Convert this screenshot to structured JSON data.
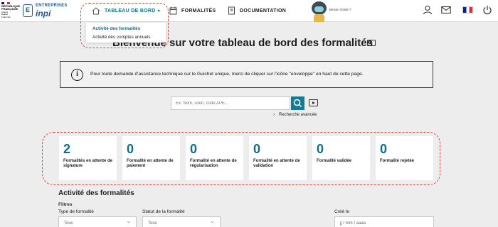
{
  "header": {
    "gov_logo_lines": [
      "RÉPUBLIQUE",
      "FRANÇAISE",
      "Liberté",
      "Égalité",
      "Fraternité"
    ],
    "brand_line1": "ENTREPRISES",
    "brand_line2": "inpi",
    "nav": [
      {
        "label": "TABLEAU DE BORD",
        "icon": "home-icon"
      },
      {
        "label": "FORMALITÉS",
        "icon": "calendar-icon"
      },
      {
        "label": "DOCUMENTATION",
        "icon": "book-icon"
      }
    ],
    "help_label": "Besoin d'aide ?",
    "icons": [
      "user-icon",
      "mail-icon",
      "french-flag-icon",
      "power-icon"
    ]
  },
  "dropdown": {
    "items": [
      "Activité des formalités",
      "Activité des comptes annuels"
    ]
  },
  "page_title": "Bienvenue sur votre tableau de bord des formalités",
  "info_text": "Pour toute demande d'assistance technique sur le Guichet unique, merci de cliquer sur l'icône \"enveloppe\" en haut de cette page.",
  "search": {
    "placeholder": "Ex: Nom, siren, code APE...",
    "advanced_label": "Recherche avancée"
  },
  "cards": [
    {
      "count": "2",
      "label": "Formalités en attente de signature"
    },
    {
      "count": "0",
      "label": "Formalité en attente de paiement"
    },
    {
      "count": "0",
      "label": "Formalité en attente de régularisation"
    },
    {
      "count": "0",
      "label": "Formalité en attente de validation"
    },
    {
      "count": "0",
      "label": "Formalité validée"
    },
    {
      "count": "0",
      "label": "Formalité rejetée"
    }
  ],
  "activity": {
    "title": "Activité des formalités",
    "filters_label": "Filtres",
    "type_label": "Type de formalité",
    "type_value": "Tous",
    "status_label": "Statut de la formalité",
    "status_value": "Tous",
    "created_label": "Créé le",
    "date_placeholder": "jj / mm / aaaa"
  },
  "colors": {
    "accent": "#137d99",
    "card_number": "#0f6e8a",
    "annotation": "#e24b3b"
  }
}
